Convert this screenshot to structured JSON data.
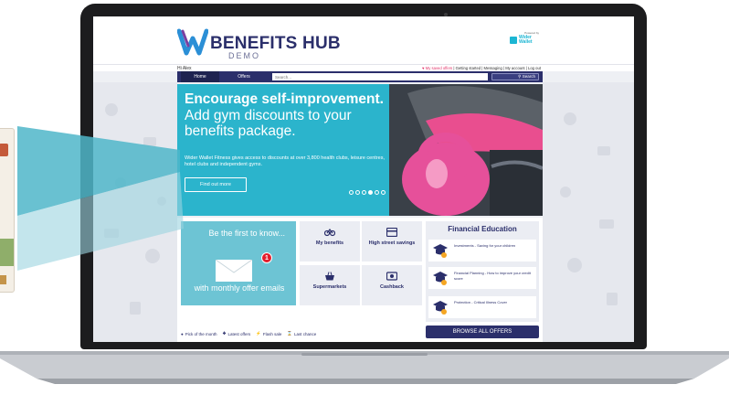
{
  "app": {
    "logo_title": "BENEFITS HUB",
    "logo_subtitle": "DEMO",
    "powered_by": "Powered by",
    "partner_name": "Wider Wallet"
  },
  "user_bar": {
    "greeting": "Hi Alex",
    "saved_offers": "My saved offers",
    "links": "| Getting started | Messaging | My account | Log out"
  },
  "nav": {
    "home": "Home",
    "offers": "Offers",
    "search_placeholder": "Search...",
    "search_button": "Search"
  },
  "hero": {
    "headline": "Encourage self-improvement.",
    "subheadline": "Add gym discounts to your benefits package.",
    "body": "Wider Wallet Fitness gives access to discounts at over 3,800 health clubs, leisure centres, hotel clubs and independent gyms.",
    "cta": "Find out more",
    "slides_total": 6,
    "active_slide": 3
  },
  "promo": {
    "top_text": "Be the first to know...",
    "bottom_text": "with monthly offer emails",
    "badge_count": "1"
  },
  "tiles": [
    {
      "label": "My benefits",
      "icon": "bicycle-icon"
    },
    {
      "label": "High street savings",
      "icon": "card-icon"
    },
    {
      "label": "Supermarkets",
      "icon": "basket-icon"
    },
    {
      "label": "Cashback",
      "icon": "cash-icon"
    }
  ],
  "financial_education": {
    "title": "Financial Education",
    "items": [
      {
        "text": "Investments - Saving for your children"
      },
      {
        "text": "Financial Planning - How to improve your credit score"
      },
      {
        "text": "Protection - Critical Illness Cover"
      }
    ]
  },
  "legend": {
    "pick": "Pick of the month",
    "latest": "Latest offers",
    "flash": "Flash sale",
    "last": "Last chance"
  },
  "browse_button": "BROWSE ALL OFFERS",
  "colors": {
    "navy": "#2b2f6b",
    "hero_cyan": "#2bb4cc",
    "accent_pink": "#e3356b",
    "badge_red": "#e21d2c"
  }
}
